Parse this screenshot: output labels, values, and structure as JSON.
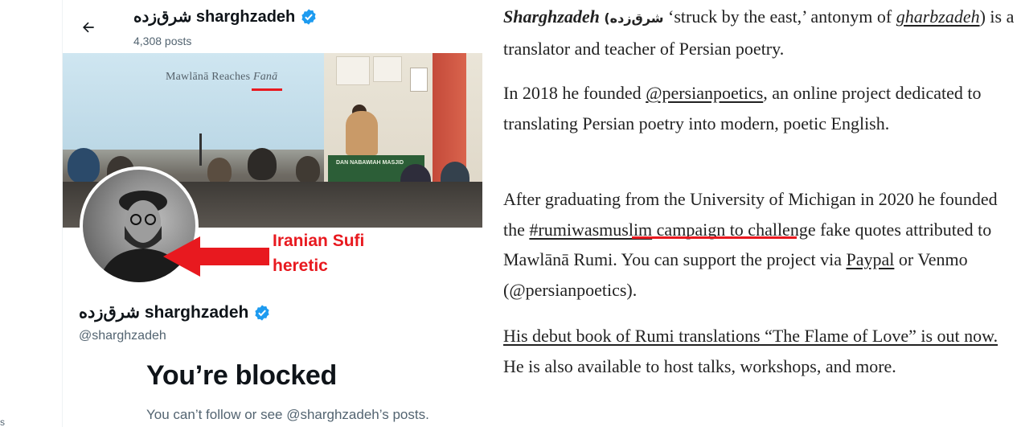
{
  "twitter_profile": {
    "header_name": "شرق‌زده sharghzadeh",
    "post_count": "4,308 posts",
    "banner": {
      "screen_text": "Mawlānā Reaches",
      "screen_text_italic": "Fanā",
      "table_text": "DAN NABAWIAH MASJID"
    },
    "annotation": "Iranian Sufi heretic",
    "display_name": "شرق‌زده sharghzadeh",
    "handle": "@sharghzadeh",
    "blocked_title": "You’re blocked",
    "blocked_subtitle": "You can’t follow or see @sharghzadeh’s posts.",
    "edge_char": "s"
  },
  "bio": {
    "p1": {
      "name": "Sharghzadeh",
      "name_persian": "(شرق‌زده",
      "text_a": "‘struck by the east,’ antonym of",
      "link_gharbzadeh": "gharbzadeh",
      "text_b": ") is a translator and teacher of Persian poetry."
    },
    "p2": {
      "text_a": "In 2018 he founded",
      "link_handle": "@persianpoetics",
      "text_b": ", an online project dedicated to translating Persian poetry into modern, poetic English."
    },
    "p3": {
      "text_a": "After graduating from the University of Michigan in 2020 he founded the",
      "link_campaign": "#rumiwasmuslim",
      "text_b": "campaign to challenge fake quotes attributed to Mawlānā Rumi. You can support the project via",
      "link_paypal": "Paypal",
      "text_c": "or Venmo (@persianpoetics)."
    },
    "p4": {
      "link_book": "His debut book of Rumi translations “The Flame of Love” is out now.",
      "text_a": "He is also available to host talks, workshops, and more."
    }
  },
  "colors": {
    "annotation_red": "#e8191f",
    "verified_blue": "#1d9bf0",
    "primary_text": "#0f1419",
    "secondary_text": "#536471"
  },
  "icons": [
    "back-arrow-icon",
    "verified-badge-icon"
  ]
}
